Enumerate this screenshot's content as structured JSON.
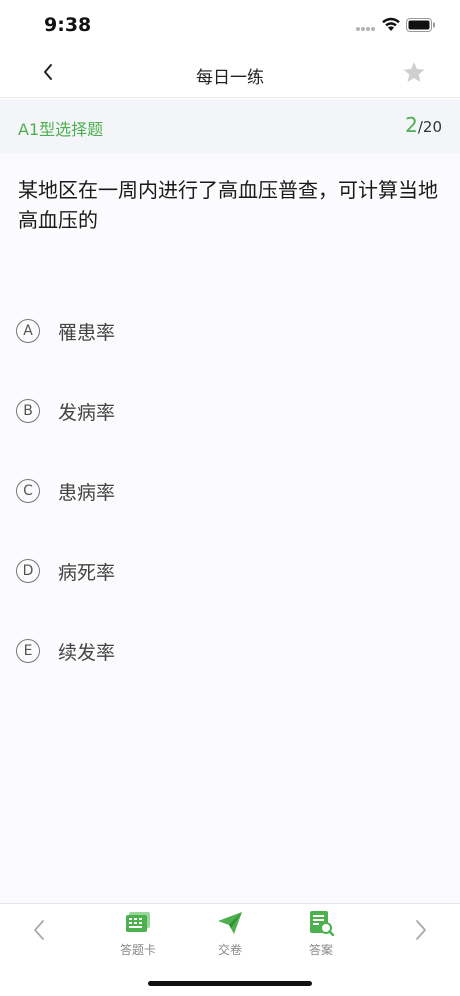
{
  "status_bar": {
    "time": "9:38"
  },
  "nav": {
    "title": "每日一练",
    "back_icon": "chevron-left-icon",
    "star_icon": "star-icon"
  },
  "sub_header": {
    "question_type": "A1型选择题",
    "progress_current": "2",
    "progress_total": "/20"
  },
  "question": {
    "text": "某地区在一周内进行了高血压普查，可计算当地高血压的"
  },
  "options": [
    {
      "letter": "A",
      "text": "罹患率"
    },
    {
      "letter": "B",
      "text": "发病率"
    },
    {
      "letter": "C",
      "text": "患病率"
    },
    {
      "letter": "D",
      "text": "病死率"
    },
    {
      "letter": "E",
      "text": "续发率"
    }
  ],
  "toolbar": {
    "answer_card_label": "答题卡",
    "submit_label": "交卷",
    "answer_label": "答案"
  },
  "colors": {
    "accent": "#4cb04e",
    "star": "#cfcfcf"
  }
}
